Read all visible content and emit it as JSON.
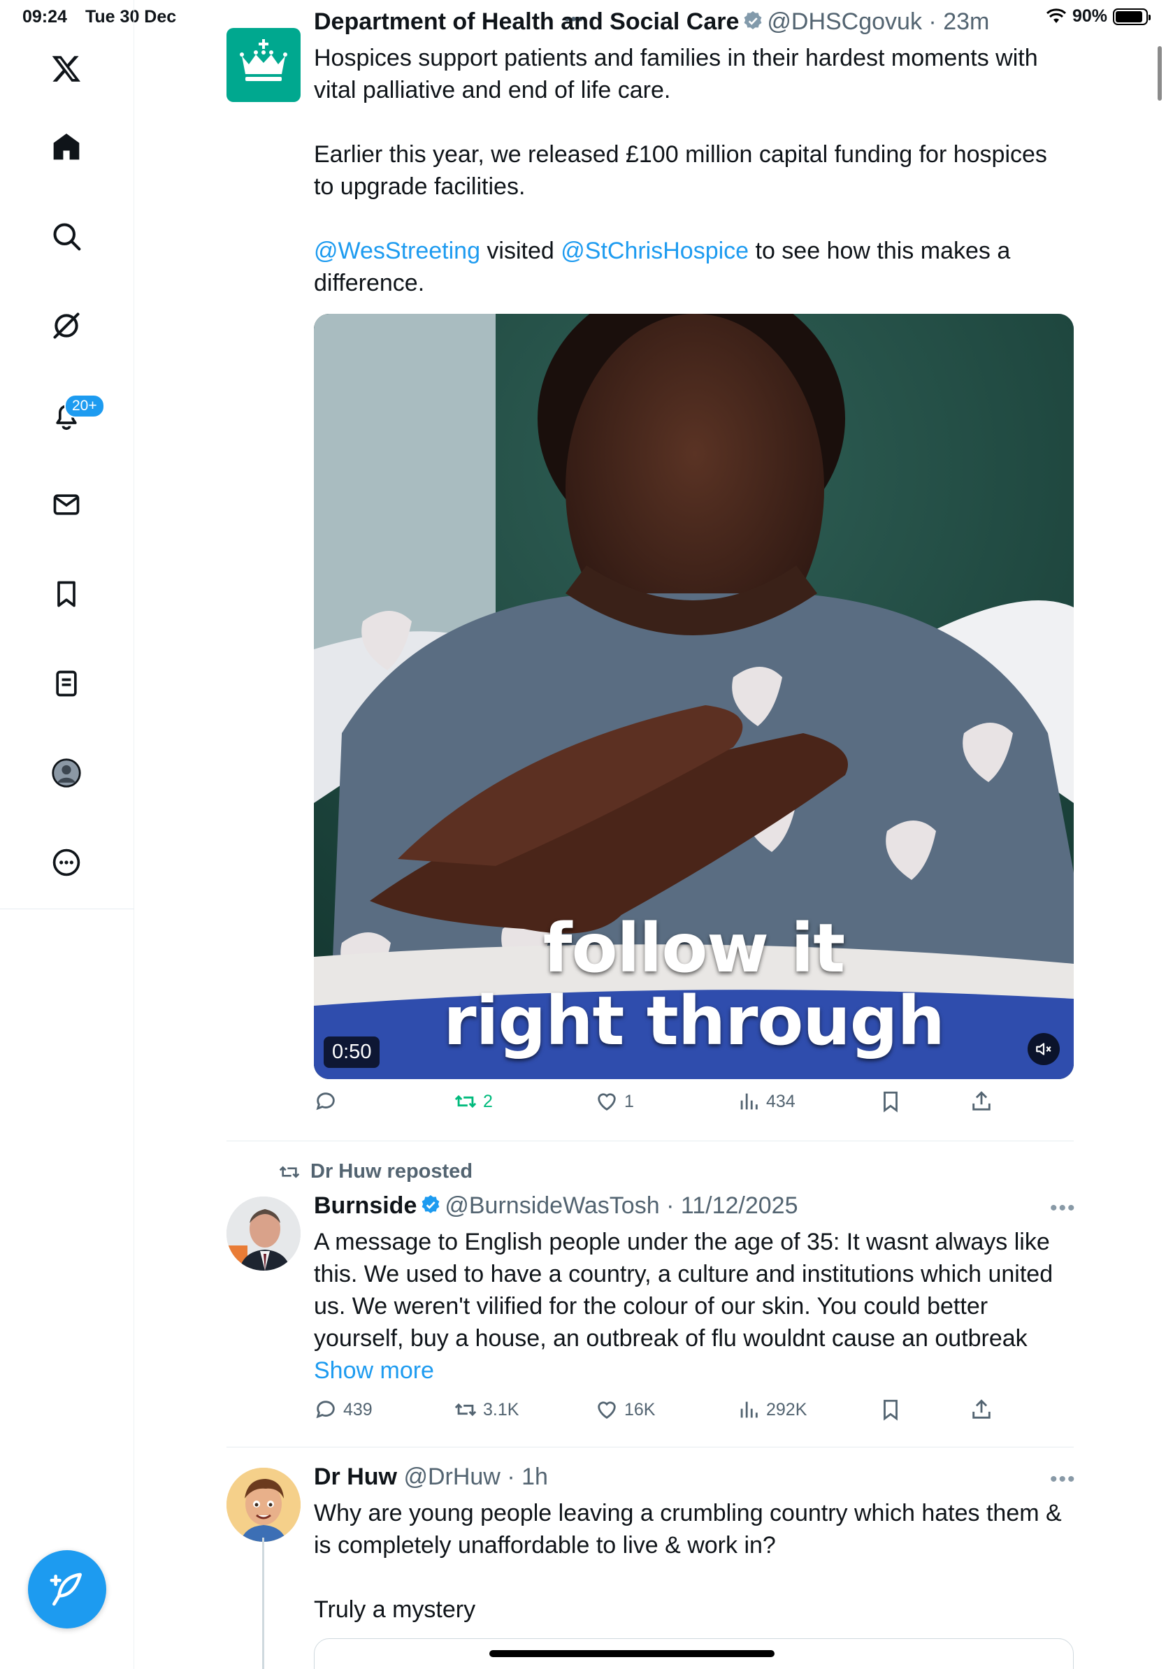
{
  "status_bar": {
    "time": "09:24",
    "date": "Tue 30 Dec",
    "battery": "90%"
  },
  "sidebar": {
    "notifications_badge": "20+",
    "items": [
      "x-logo",
      "home",
      "explore",
      "grok",
      "notifications",
      "messages",
      "bookmarks",
      "lists",
      "profile",
      "more"
    ]
  },
  "tweets": [
    {
      "name": "Department of Health and Social Care",
      "handle": "@DHSCgovuk",
      "time": "23m",
      "body": [
        "Hospices support patients and families in their hardest moments with vital palliative and end of life care.",
        "Earlier this year, we released £100 million capital funding for hospices to upgrade facilities."
      ],
      "mention1": "@WesStreeting",
      "visited": " visited ",
      "mention2": "@StChrisHospice",
      "tail": " to see how this makes a difference.",
      "video": {
        "duration": "0:50",
        "caption_line1": "follow it",
        "caption_line2": "right through"
      },
      "stats": {
        "replies": "",
        "reposts": "2",
        "likes": "1",
        "views": "434"
      }
    },
    {
      "reposted_by": "Dr Huw reposted",
      "name": "Burnside",
      "handle": "@BurnsideWasTosh",
      "time": "11/12/2025",
      "body": "A message to English people under the age of 35: It wasnt always like this. We used to have a country, a culture and institutions which united us. We weren't vilified for the colour of our skin. You could better yourself, buy a house, an outbreak of flu wouldnt cause an outbreak ",
      "show_more": "Show more",
      "stats": {
        "replies": "439",
        "reposts": "3.1K",
        "likes": "16K",
        "views": "292K"
      }
    },
    {
      "name": "Dr Huw",
      "handle": "@DrHuw",
      "time": "1h",
      "body": "Why are young people leaving a crumbling country which hates them & is completely unaffordable to live & work in?",
      "body2": "Truly a mystery"
    }
  ],
  "colors": {
    "accent": "#1d9bf0",
    "repost_green": "#00ba7c",
    "dhsc_teal": "#00a88f",
    "muted": "#536471"
  },
  "icons": [
    "x-logo-icon",
    "home-icon",
    "search-icon",
    "grok-icon",
    "bell-icon",
    "mail-icon",
    "bookmark-icon",
    "list-icon",
    "profile-icon",
    "more-icon",
    "compose-icon",
    "reply-icon",
    "repost-icon",
    "like-icon",
    "views-icon",
    "share-icon",
    "mute-icon",
    "verified-icon"
  ]
}
